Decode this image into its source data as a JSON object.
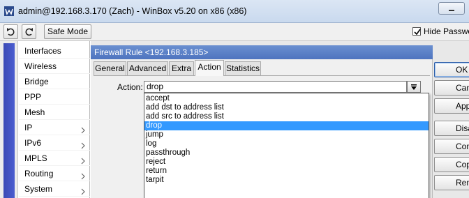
{
  "window": {
    "title": "admin@192.168.3.170 (Zach) - WinBox v5.20 on x86 (x86)"
  },
  "toolbar": {
    "undo_icon": "undo-icon",
    "redo_icon": "redo-icon",
    "safe_mode_label": "Safe Mode",
    "hide_passwords_label": "Hide Passwor",
    "hide_passwords_checked": true
  },
  "sidebar": {
    "items": [
      {
        "label": "Interfaces",
        "has_submenu": false
      },
      {
        "label": "Wireless",
        "has_submenu": false
      },
      {
        "label": "Bridge",
        "has_submenu": false
      },
      {
        "label": "PPP",
        "has_submenu": false
      },
      {
        "label": "Mesh",
        "has_submenu": false
      },
      {
        "label": "IP",
        "has_submenu": true
      },
      {
        "label": "IPv6",
        "has_submenu": true
      },
      {
        "label": "MPLS",
        "has_submenu": true
      },
      {
        "label": "Routing",
        "has_submenu": true
      },
      {
        "label": "System",
        "has_submenu": true
      }
    ]
  },
  "dialog": {
    "title": "Firewall Rule <192.168.3.185>",
    "tabs": [
      {
        "label": "General",
        "active": false
      },
      {
        "label": "Advanced",
        "active": false
      },
      {
        "label": "Extra",
        "active": false
      },
      {
        "label": "Action",
        "active": true
      },
      {
        "label": "Statistics",
        "active": false
      }
    ],
    "action_label": "Action:",
    "action_value": "drop",
    "action_options": [
      {
        "label": "accept",
        "selected": false
      },
      {
        "label": "add dst to address list",
        "selected": false
      },
      {
        "label": "add src to address list",
        "selected": false
      },
      {
        "label": "drop",
        "selected": true
      },
      {
        "label": "jump",
        "selected": false
      },
      {
        "label": "log",
        "selected": false
      },
      {
        "label": "passthrough",
        "selected": false
      },
      {
        "label": "reject",
        "selected": false
      },
      {
        "label": "return",
        "selected": false
      },
      {
        "label": "tarpit",
        "selected": false
      }
    ]
  },
  "side_buttons": [
    {
      "label": "OK"
    },
    {
      "label": "Cancel"
    },
    {
      "label": "Apply"
    },
    {
      "label": "Disable"
    },
    {
      "label": "Comment"
    },
    {
      "label": "Copy"
    },
    {
      "label": "Remove"
    }
  ],
  "colors": {
    "selection": "#3399ff",
    "dialog_header": "#4e74bf",
    "sidebar_strip": "#3b4ab5"
  }
}
